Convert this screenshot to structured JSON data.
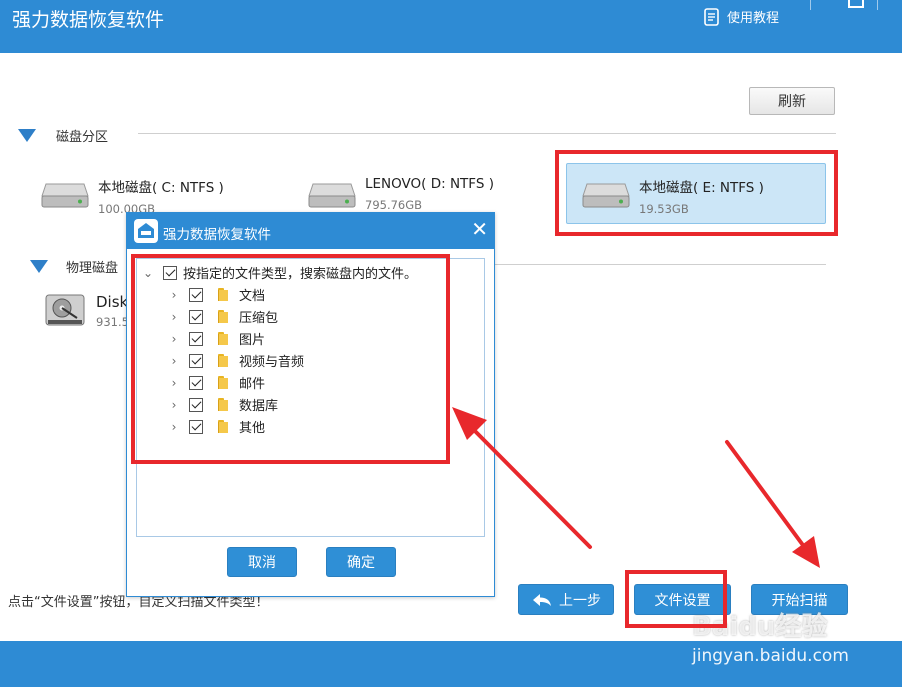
{
  "app": {
    "title": "强力数据恢复软件",
    "help_label": "使用教程"
  },
  "toolbar": {
    "refresh_label": "刷新"
  },
  "partitions": {
    "section_label": "磁盘分区",
    "disks": [
      {
        "name": "本地磁盘( C: NTFS )",
        "size": "100.00GB"
      },
      {
        "name": "LENOVO( D: NTFS )",
        "size": "795.76GB"
      },
      {
        "name": "本地磁盘( E: NTFS )",
        "size": "19.53GB"
      }
    ]
  },
  "physical": {
    "section_label": "物理磁盘",
    "disks": [
      {
        "name": "Disk",
        "size": "931.5"
      }
    ]
  },
  "dialog": {
    "title": "强力数据恢复软件",
    "root_label": "按指定的文件类型，搜索磁盘内的文件。",
    "items": [
      {
        "label": "文档"
      },
      {
        "label": "压缩包"
      },
      {
        "label": "图片"
      },
      {
        "label": "视频与音频"
      },
      {
        "label": "邮件"
      },
      {
        "label": "数据库"
      },
      {
        "label": "其他"
      }
    ],
    "cancel_label": "取消",
    "ok_label": "确定"
  },
  "hint": "点击“文件设置”按钮，自定义扫描文件类型！",
  "nav": {
    "prev_label": "上一步",
    "file_settings_label": "文件设置",
    "start_scan_label": "开始扫描"
  },
  "watermark": {
    "brand": "Baidu经验",
    "url": "jingyan.baidu.com"
  },
  "colors": {
    "accent": "#2e8bd4",
    "annotation": "#e8282c",
    "selected_bg": "#cce6f7"
  }
}
